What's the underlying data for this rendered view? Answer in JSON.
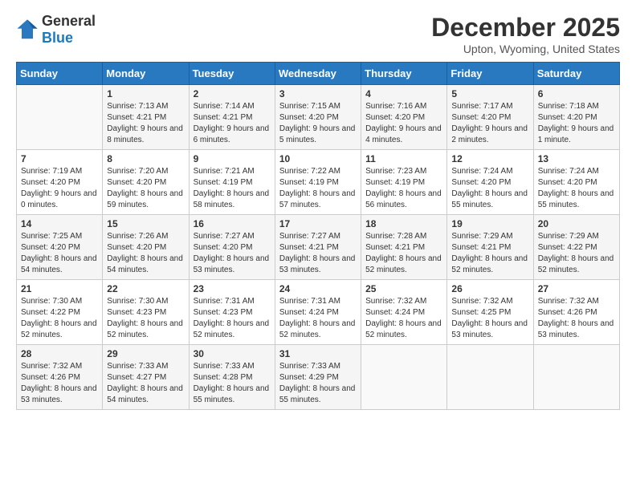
{
  "logo": {
    "general": "General",
    "blue": "Blue"
  },
  "title": "December 2025",
  "location": "Upton, Wyoming, United States",
  "days_of_week": [
    "Sunday",
    "Monday",
    "Tuesday",
    "Wednesday",
    "Thursday",
    "Friday",
    "Saturday"
  ],
  "weeks": [
    [
      {
        "day": "",
        "sunrise": "",
        "sunset": "",
        "daylight": ""
      },
      {
        "day": "1",
        "sunrise": "Sunrise: 7:13 AM",
        "sunset": "Sunset: 4:21 PM",
        "daylight": "Daylight: 9 hours and 8 minutes."
      },
      {
        "day": "2",
        "sunrise": "Sunrise: 7:14 AM",
        "sunset": "Sunset: 4:21 PM",
        "daylight": "Daylight: 9 hours and 6 minutes."
      },
      {
        "day": "3",
        "sunrise": "Sunrise: 7:15 AM",
        "sunset": "Sunset: 4:20 PM",
        "daylight": "Daylight: 9 hours and 5 minutes."
      },
      {
        "day": "4",
        "sunrise": "Sunrise: 7:16 AM",
        "sunset": "Sunset: 4:20 PM",
        "daylight": "Daylight: 9 hours and 4 minutes."
      },
      {
        "day": "5",
        "sunrise": "Sunrise: 7:17 AM",
        "sunset": "Sunset: 4:20 PM",
        "daylight": "Daylight: 9 hours and 2 minutes."
      },
      {
        "day": "6",
        "sunrise": "Sunrise: 7:18 AM",
        "sunset": "Sunset: 4:20 PM",
        "daylight": "Daylight: 9 hours and 1 minute."
      }
    ],
    [
      {
        "day": "7",
        "sunrise": "Sunrise: 7:19 AM",
        "sunset": "Sunset: 4:20 PM",
        "daylight": "Daylight: 9 hours and 0 minutes."
      },
      {
        "day": "8",
        "sunrise": "Sunrise: 7:20 AM",
        "sunset": "Sunset: 4:20 PM",
        "daylight": "Daylight: 8 hours and 59 minutes."
      },
      {
        "day": "9",
        "sunrise": "Sunrise: 7:21 AM",
        "sunset": "Sunset: 4:19 PM",
        "daylight": "Daylight: 8 hours and 58 minutes."
      },
      {
        "day": "10",
        "sunrise": "Sunrise: 7:22 AM",
        "sunset": "Sunset: 4:19 PM",
        "daylight": "Daylight: 8 hours and 57 minutes."
      },
      {
        "day": "11",
        "sunrise": "Sunrise: 7:23 AM",
        "sunset": "Sunset: 4:19 PM",
        "daylight": "Daylight: 8 hours and 56 minutes."
      },
      {
        "day": "12",
        "sunrise": "Sunrise: 7:24 AM",
        "sunset": "Sunset: 4:20 PM",
        "daylight": "Daylight: 8 hours and 55 minutes."
      },
      {
        "day": "13",
        "sunrise": "Sunrise: 7:24 AM",
        "sunset": "Sunset: 4:20 PM",
        "daylight": "Daylight: 8 hours and 55 minutes."
      }
    ],
    [
      {
        "day": "14",
        "sunrise": "Sunrise: 7:25 AM",
        "sunset": "Sunset: 4:20 PM",
        "daylight": "Daylight: 8 hours and 54 minutes."
      },
      {
        "day": "15",
        "sunrise": "Sunrise: 7:26 AM",
        "sunset": "Sunset: 4:20 PM",
        "daylight": "Daylight: 8 hours and 54 minutes."
      },
      {
        "day": "16",
        "sunrise": "Sunrise: 7:27 AM",
        "sunset": "Sunset: 4:20 PM",
        "daylight": "Daylight: 8 hours and 53 minutes."
      },
      {
        "day": "17",
        "sunrise": "Sunrise: 7:27 AM",
        "sunset": "Sunset: 4:21 PM",
        "daylight": "Daylight: 8 hours and 53 minutes."
      },
      {
        "day": "18",
        "sunrise": "Sunrise: 7:28 AM",
        "sunset": "Sunset: 4:21 PM",
        "daylight": "Daylight: 8 hours and 52 minutes."
      },
      {
        "day": "19",
        "sunrise": "Sunrise: 7:29 AM",
        "sunset": "Sunset: 4:21 PM",
        "daylight": "Daylight: 8 hours and 52 minutes."
      },
      {
        "day": "20",
        "sunrise": "Sunrise: 7:29 AM",
        "sunset": "Sunset: 4:22 PM",
        "daylight": "Daylight: 8 hours and 52 minutes."
      }
    ],
    [
      {
        "day": "21",
        "sunrise": "Sunrise: 7:30 AM",
        "sunset": "Sunset: 4:22 PM",
        "daylight": "Daylight: 8 hours and 52 minutes."
      },
      {
        "day": "22",
        "sunrise": "Sunrise: 7:30 AM",
        "sunset": "Sunset: 4:23 PM",
        "daylight": "Daylight: 8 hours and 52 minutes."
      },
      {
        "day": "23",
        "sunrise": "Sunrise: 7:31 AM",
        "sunset": "Sunset: 4:23 PM",
        "daylight": "Daylight: 8 hours and 52 minutes."
      },
      {
        "day": "24",
        "sunrise": "Sunrise: 7:31 AM",
        "sunset": "Sunset: 4:24 PM",
        "daylight": "Daylight: 8 hours and 52 minutes."
      },
      {
        "day": "25",
        "sunrise": "Sunrise: 7:32 AM",
        "sunset": "Sunset: 4:24 PM",
        "daylight": "Daylight: 8 hours and 52 minutes."
      },
      {
        "day": "26",
        "sunrise": "Sunrise: 7:32 AM",
        "sunset": "Sunset: 4:25 PM",
        "daylight": "Daylight: 8 hours and 53 minutes."
      },
      {
        "day": "27",
        "sunrise": "Sunrise: 7:32 AM",
        "sunset": "Sunset: 4:26 PM",
        "daylight": "Daylight: 8 hours and 53 minutes."
      }
    ],
    [
      {
        "day": "28",
        "sunrise": "Sunrise: 7:32 AM",
        "sunset": "Sunset: 4:26 PM",
        "daylight": "Daylight: 8 hours and 53 minutes."
      },
      {
        "day": "29",
        "sunrise": "Sunrise: 7:33 AM",
        "sunset": "Sunset: 4:27 PM",
        "daylight": "Daylight: 8 hours and 54 minutes."
      },
      {
        "day": "30",
        "sunrise": "Sunrise: 7:33 AM",
        "sunset": "Sunset: 4:28 PM",
        "daylight": "Daylight: 8 hours and 55 minutes."
      },
      {
        "day": "31",
        "sunrise": "Sunrise: 7:33 AM",
        "sunset": "Sunset: 4:29 PM",
        "daylight": "Daylight: 8 hours and 55 minutes."
      },
      {
        "day": "",
        "sunrise": "",
        "sunset": "",
        "daylight": ""
      },
      {
        "day": "",
        "sunrise": "",
        "sunset": "",
        "daylight": ""
      },
      {
        "day": "",
        "sunrise": "",
        "sunset": "",
        "daylight": ""
      }
    ]
  ]
}
